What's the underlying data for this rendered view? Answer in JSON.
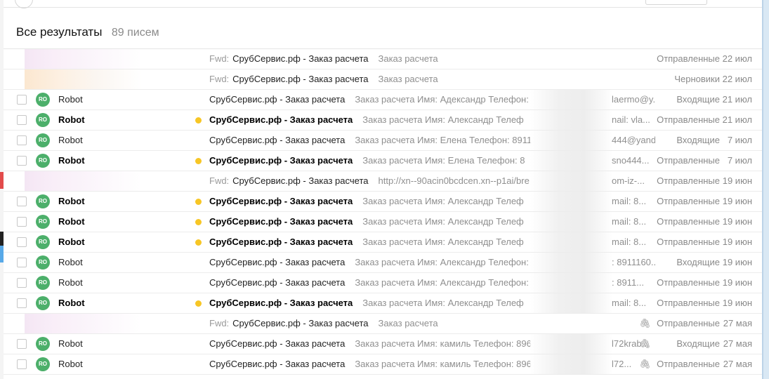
{
  "header": {
    "title": "Все результаты",
    "count": "89 писем"
  },
  "messages": [
    {
      "sender": "",
      "bold": false,
      "fwd": "Fwd:",
      "subject": "СрубСервис.рф - Заказ расчета",
      "snippet": "Заказ расчета",
      "snippet_end": "",
      "attachment": false,
      "folder": "Отправленные",
      "date": "22 июл",
      "sender_hidden": true
    },
    {
      "sender": "",
      "bold": false,
      "fwd": "Fwd:",
      "subject": "СрубСервис.рф - Заказ расчета",
      "snippet": "Заказ расчета",
      "snippet_end": "",
      "attachment": false,
      "folder": "Черновики",
      "date": "22 июл",
      "sender_hidden": true
    },
    {
      "sender": "Robot",
      "avatar": "RO",
      "bold": false,
      "fwd": "",
      "subject": "СрубСервис.рф - Заказ расчета",
      "snippet": "Заказ расчета Имя: Адександр Телефон:",
      "snippet_end": "laermo@y...",
      "attachment": false,
      "folder": "Входящие",
      "date": "21 июл"
    },
    {
      "sender": "Robot",
      "avatar": "RO",
      "bold": true,
      "fwd": "",
      "subject": "СрубСервис.рф - Заказ расчета",
      "snippet": "Заказ расчета Имя: Александр Телеф",
      "snippet_end": "nail: vla...",
      "attachment": false,
      "folder": "Отправленные",
      "date": "21 июл"
    },
    {
      "sender": "Robot",
      "avatar": "RO",
      "bold": false,
      "fwd": "",
      "subject": "СрубСервис.рф - Заказ расчета",
      "snippet": "Заказ расчета Имя: Елена Телефон: 8911",
      "snippet_end": "444@yand...",
      "attachment": false,
      "folder": "Входящие",
      "date": "7 июл"
    },
    {
      "sender": "Robot",
      "avatar": "RO",
      "bold": true,
      "fwd": "",
      "subject": "СрубСервис.рф - Заказ расчета",
      "snippet": "Заказ расчета Имя: Елена Телефон: 8",
      "snippet_end": "sno444...",
      "attachment": false,
      "folder": "Отправленные",
      "date": "7 июл"
    },
    {
      "sender": "",
      "bold": false,
      "fwd": "Fwd:",
      "subject": "СрубСервис.рф - Заказ расчета",
      "snippet": "http://xn--90acin0bcdcen.xn--p1ai/bre",
      "snippet_end": "om-iz-...",
      "attachment": false,
      "folder": "Отправленные",
      "date": "19 июн",
      "sender_hidden": true
    },
    {
      "sender": "Robot",
      "avatar": "RO",
      "bold": true,
      "fwd": "",
      "subject": "СрубСервис.рф - Заказ расчета",
      "snippet": "Заказ расчета Имя: Александр Телеф",
      "snippet_end": "mail: 8...",
      "attachment": false,
      "folder": "Отправленные",
      "date": "19 июн"
    },
    {
      "sender": "Robot",
      "avatar": "RO",
      "bold": true,
      "fwd": "",
      "subject": "СрубСервис.рф - Заказ расчета",
      "snippet": "Заказ расчета Имя: Александр Телеф",
      "snippet_end": "mail: 8...",
      "attachment": false,
      "folder": "Отправленные",
      "date": "19 июн"
    },
    {
      "sender": "Robot",
      "avatar": "RO",
      "bold": true,
      "fwd": "",
      "subject": "СрубСервис.рф - Заказ расчета",
      "snippet": "Заказ расчета Имя: Александр Телеф",
      "snippet_end": "mail: 8...",
      "attachment": false,
      "folder": "Отправленные",
      "date": "19 июн"
    },
    {
      "sender": "Robot",
      "avatar": "RO",
      "bold": false,
      "fwd": "",
      "subject": "СрубСервис.рф - Заказ расчета",
      "snippet": "Заказ расчета Имя: Александр Телефон:",
      "snippet_end": ": 8911160...",
      "attachment": false,
      "folder": "Входящие",
      "date": "19 июн"
    },
    {
      "sender": "Robot",
      "avatar": "RO",
      "bold": false,
      "fwd": "",
      "subject": "СрубСервис.рф - Заказ расчета",
      "snippet": "Заказ расчета Имя: Александр Телефон:",
      "snippet_end": ": 8911...",
      "attachment": false,
      "folder": "Отправленные",
      "date": "19 июн"
    },
    {
      "sender": "Robot",
      "avatar": "RO",
      "bold": true,
      "fwd": "",
      "subject": "СрубСервис.рф - Заказ расчета",
      "snippet": "Заказ расчета Имя: Александр Телеф",
      "snippet_end": "mail: 8...",
      "attachment": false,
      "folder": "Отправленные",
      "date": "19 июн"
    },
    {
      "sender": "",
      "bold": false,
      "fwd": "Fwd:",
      "subject": "СрубСервис.рф - Заказ расчета",
      "snippet": "Заказ расчета",
      "snippet_end": "",
      "attachment": true,
      "folder": "Отправленные",
      "date": "27 мая",
      "sender_hidden": true
    },
    {
      "sender": "Robot",
      "avatar": "RO",
      "bold": false,
      "fwd": "",
      "subject": "СрубСервис.рф - Заказ расчета",
      "snippet": "Заказ расчета Имя: камиль Телефон: 896",
      "snippet_end": "l72krab...",
      "attachment": true,
      "folder": "Входящие",
      "date": "27 мая"
    },
    {
      "sender": "Robot",
      "avatar": "RO",
      "bold": false,
      "fwd": "",
      "subject": "СрубСервис.рф - Заказ расчета",
      "snippet": "Заказ расчета Имя: камиль Телефон: 896",
      "snippet_end": "l72...",
      "attachment": true,
      "folder": "Отправленные",
      "date": "27 мая"
    }
  ],
  "colors": {
    "unread_dot": "#f7c625",
    "avatar_bg": "#4caf6a",
    "muted_text": "#8a8a8a"
  },
  "icons": {
    "attachment": "paperclip-icon",
    "unread": "unread-dot-icon"
  }
}
